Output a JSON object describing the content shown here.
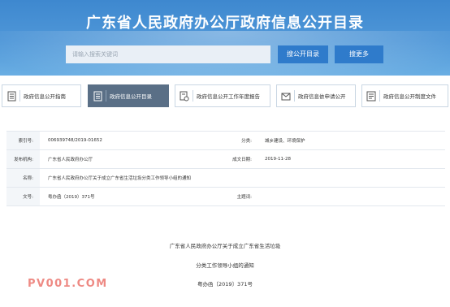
{
  "header": {
    "title": "广东省人民政府办公厅政府信息公开目录",
    "search_placeholder": "请输入搜索关键词",
    "search_button": "搜公开目录",
    "more_button": "搜更多"
  },
  "tabs": [
    {
      "label": "政府信息公开指南",
      "icon": "document-icon",
      "active": false
    },
    {
      "label": "政府信息公开目录",
      "icon": "list-icon",
      "active": true
    },
    {
      "label": "政府信息公开工作年度报告",
      "icon": "report-icon",
      "active": false
    },
    {
      "label": "政府信息依申请公开",
      "icon": "request-icon",
      "active": false
    },
    {
      "label": "政府信息公开制度文件",
      "icon": "policy-icon",
      "active": false
    }
  ],
  "meta": {
    "index_label": "索引号:",
    "index_value": "006939748/2019-01652",
    "category_label": "分类:",
    "category_value": "城乡建设、环境保护",
    "issuer_label": "发布机构:",
    "issuer_value": "广东省人民政府办公厅",
    "date_label": "成文日期:",
    "date_value": "2019-11-28",
    "name_label": "名称:",
    "name_value": "广东省人民政府办公厅关于成立广东省生活垃圾分类工作领导小组的通知",
    "docno_label": "文号:",
    "docno_value": "粤办函（2019）371号",
    "keywords_label": "主题词:",
    "keywords_value": ""
  },
  "document": {
    "title_line1": "广东省人民政府办公厅关于成立广东省生活垃圾",
    "title_line2": "分类工作领导小组的通知",
    "doc_number": "粤办函〔2019〕371号"
  },
  "watermark": "PV001.COM",
  "colors": {
    "header_bg": "#4a91d6",
    "button": "#2f7bcb",
    "active_tab": "#5a6f86",
    "watermark": "#ee8a84"
  }
}
